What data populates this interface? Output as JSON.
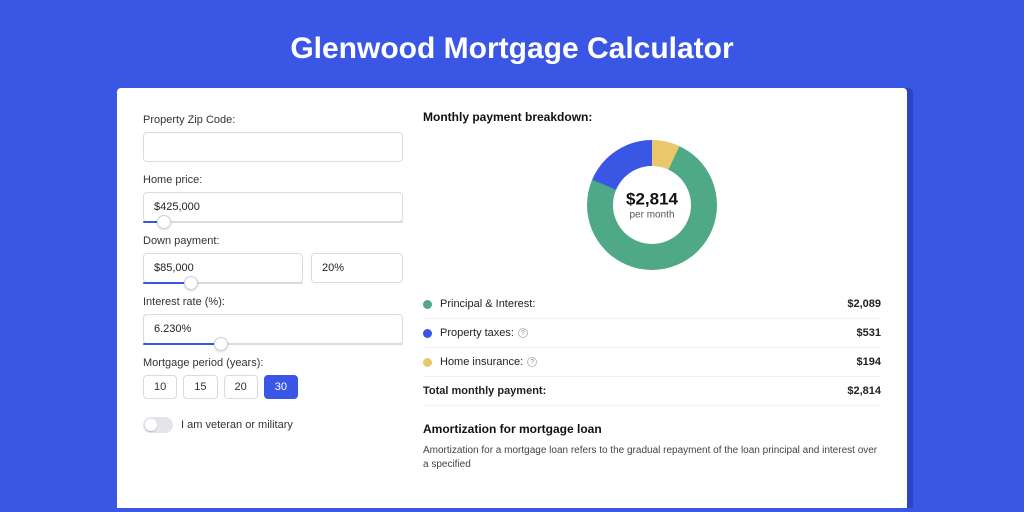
{
  "title": "Glenwood Mortgage Calculator",
  "form": {
    "zip_label": "Property Zip Code:",
    "zip_value": "",
    "home_price_label": "Home price:",
    "home_price_value": "$425,000",
    "down_payment_label": "Down payment:",
    "down_payment_value": "$85,000",
    "down_payment_pct": "20%",
    "interest_label": "Interest rate (%):",
    "interest_value": "6.230%",
    "term_label": "Mortgage period (years):",
    "terms": [
      "10",
      "15",
      "20",
      "30"
    ],
    "term_active_index": 3,
    "veteran_label": "I am veteran or military",
    "veteran_on": false
  },
  "breakdown": {
    "title": "Monthly payment breakdown:",
    "center_amount": "$2,814",
    "center_sub": "per month",
    "items": [
      {
        "label": "Principal & Interest:",
        "value": "$2,089",
        "color": "#4fa886",
        "info": false
      },
      {
        "label": "Property taxes:",
        "value": "$531",
        "color": "#3956e5",
        "info": true
      },
      {
        "label": "Home insurance:",
        "value": "$194",
        "color": "#e8c86a",
        "info": true
      }
    ],
    "total_label": "Total monthly payment:",
    "total_value": "$2,814"
  },
  "amortization": {
    "title": "Amortization for mortgage loan",
    "text": "Amortization for a mortgage loan refers to the gradual repayment of the loan principal and interest over a specified"
  },
  "chart_data": {
    "type": "pie",
    "title": "Monthly payment breakdown",
    "series": [
      {
        "name": "Principal & Interest",
        "value": 2089,
        "color": "#4fa886"
      },
      {
        "name": "Property taxes",
        "value": 531,
        "color": "#3956e5"
      },
      {
        "name": "Home insurance",
        "value": 194,
        "color": "#e8c86a"
      }
    ],
    "total": 2814,
    "center_label": "$2,814 per month"
  }
}
